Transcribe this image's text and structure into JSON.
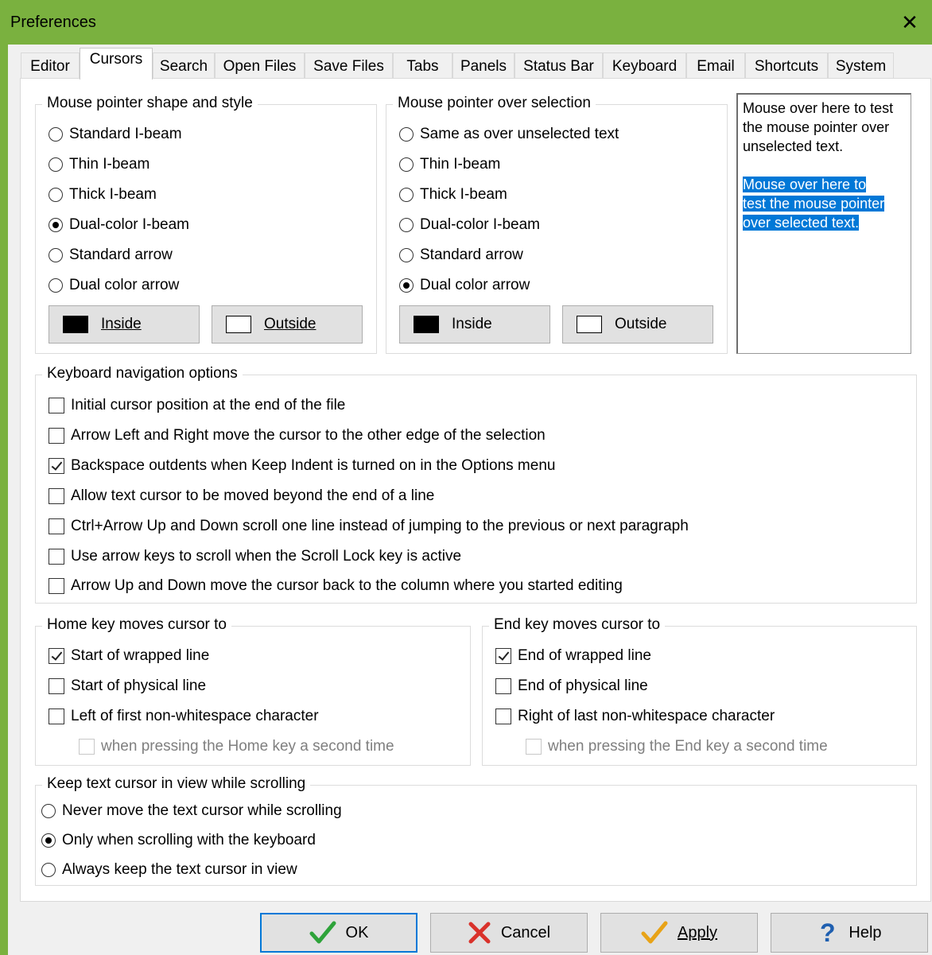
{
  "window": {
    "title": "Preferences"
  },
  "tabs": [
    "Editor",
    "Cursors",
    "Search",
    "Open Files",
    "Save Files",
    "Tabs",
    "Panels",
    "Status Bar",
    "Keyboard",
    "Email",
    "Shortcuts",
    "System"
  ],
  "active_tab": "Cursors",
  "mouse_shape": {
    "legend": "Mouse pointer shape and style",
    "options": [
      "Standard I-beam",
      "Thin I-beam",
      "Thick I-beam",
      "Dual-color I-beam",
      "Standard arrow",
      "Dual color arrow"
    ],
    "selected": "Dual-color I-beam",
    "inside_label": "Inside",
    "outside_label": "Outside"
  },
  "mouse_selection": {
    "legend": "Mouse pointer over selection",
    "options": [
      "Same as over unselected text",
      "Thin I-beam",
      "Thick I-beam",
      "Dual-color I-beam",
      "Standard arrow",
      "Dual color arrow"
    ],
    "selected": "Dual color arrow",
    "inside_label": "Inside",
    "outside_label": "Outside"
  },
  "test_area": {
    "unselected_text": "Mouse over here to test the mouse pointer over unselected text.",
    "selected_lines": [
      "Mouse over here to",
      "test the mouse pointer",
      "over selected text."
    ]
  },
  "keyboard_nav": {
    "legend": "Keyboard navigation options",
    "options": [
      {
        "label": "Initial cursor position at the end of the file",
        "checked": false
      },
      {
        "label": "Arrow Left and Right move the cursor to the other edge of the selection",
        "checked": false
      },
      {
        "label": "Backspace outdents when Keep Indent is turned on in the Options menu",
        "checked": true
      },
      {
        "label": "Allow text cursor to be moved beyond the end of a line",
        "checked": false
      },
      {
        "label": "Ctrl+Arrow Up and Down scroll one line instead of jumping to the previous or next paragraph",
        "checked": false
      },
      {
        "label": "Use arrow keys to scroll when the Scroll Lock key is active",
        "checked": false
      },
      {
        "label": "Arrow Up and Down move the cursor back to the column where you started editing",
        "checked": false
      }
    ]
  },
  "home_key": {
    "legend": "Home key moves cursor to",
    "options": [
      {
        "label": "Start of wrapped line",
        "checked": true
      },
      {
        "label": "Start of physical line",
        "checked": false
      },
      {
        "label": "Left of first non-whitespace character",
        "checked": false
      }
    ],
    "sub_option": "when pressing the Home key a second time"
  },
  "end_key": {
    "legend": "End key moves cursor to",
    "options": [
      {
        "label": "End of wrapped line",
        "checked": true
      },
      {
        "label": "End of physical line",
        "checked": false
      },
      {
        "label": "Right of last non-whitespace character",
        "checked": false
      }
    ],
    "sub_option": "when pressing the End key a second time"
  },
  "scroll_view": {
    "legend": "Keep text cursor in view while scrolling",
    "options": [
      "Never move the text cursor while scrolling",
      "Only when scrolling with the keyboard",
      "Always keep the text cursor in view"
    ],
    "selected": "Only when scrolling with the keyboard"
  },
  "buttons": {
    "ok": "OK",
    "cancel": "Cancel",
    "apply": "Apply",
    "help": "Help"
  },
  "colors": {
    "title_bar": "#7ab13f",
    "selection": "#0078d7",
    "ok_check": "#2ea33a",
    "cancel_x": "#d9322b",
    "apply_check": "#e8a317",
    "help_q": "#1f5fb0"
  }
}
